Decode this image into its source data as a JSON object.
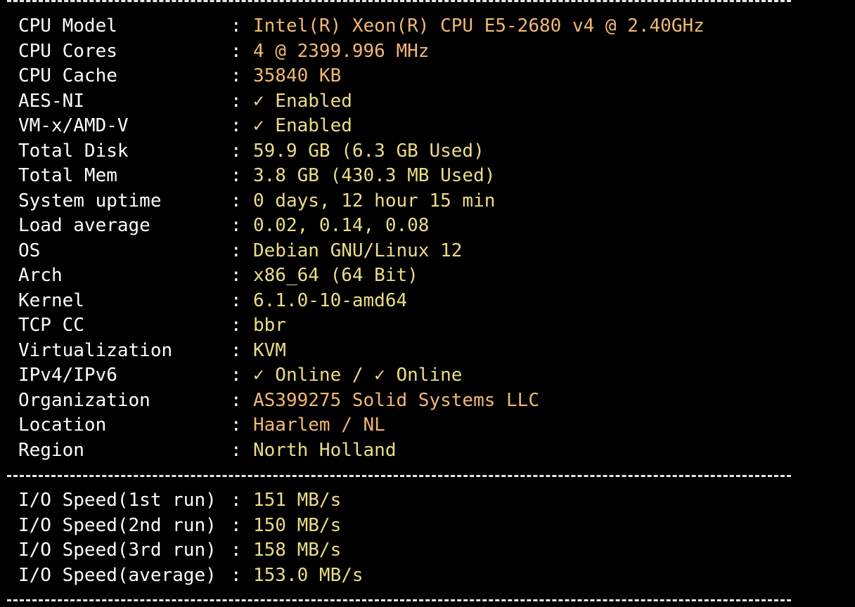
{
  "colors": {
    "background": "#000000",
    "label": "#ffffff",
    "value_orange": "#f1b873",
    "value_yellow": "#ecdd85"
  },
  "separator": ":",
  "system_info": [
    {
      "label": "CPU Model",
      "value": "Intel(R) Xeon(R) CPU E5-2680 v4 @ 2.40GHz",
      "color": "orange"
    },
    {
      "label": "CPU Cores",
      "value": "4 @ 2399.996 MHz",
      "color": "orange"
    },
    {
      "label": "CPU Cache",
      "value": "35840 KB",
      "color": "orange"
    },
    {
      "label": "AES-NI",
      "value": "✓ Enabled",
      "color": "yellow"
    },
    {
      "label": "VM-x/AMD-V",
      "value": "✓ Enabled",
      "color": "yellow"
    },
    {
      "label": "Total Disk",
      "value": "59.9 GB (6.3 GB Used)",
      "color": "yellow"
    },
    {
      "label": "Total Mem",
      "value": "3.8 GB (430.3 MB Used)",
      "color": "yellow"
    },
    {
      "label": "System uptime",
      "value": "0 days, 12 hour 15 min",
      "color": "yellow"
    },
    {
      "label": "Load average",
      "value": "0.02, 0.14, 0.08",
      "color": "yellow"
    },
    {
      "label": "OS",
      "value": "Debian GNU/Linux 12",
      "color": "yellow"
    },
    {
      "label": "Arch",
      "value": "x86_64 (64 Bit)",
      "color": "yellow"
    },
    {
      "label": "Kernel",
      "value": "6.1.0-10-amd64",
      "color": "yellow"
    },
    {
      "label": "TCP CC",
      "value": "bbr",
      "color": "yellow"
    },
    {
      "label": "Virtualization",
      "value": "KVM",
      "color": "yellow"
    },
    {
      "label": "IPv4/IPv6",
      "value": "✓ Online / ✓ Online",
      "color": "yellow"
    },
    {
      "label": "Organization",
      "value": "AS399275 Solid Systems LLC",
      "color": "orange"
    },
    {
      "label": "Location",
      "value": "Haarlem / NL",
      "color": "orange"
    },
    {
      "label": "Region",
      "value": "North Holland",
      "color": "yellow"
    }
  ],
  "io_speed": [
    {
      "label": "I/O Speed(1st run)",
      "value": "151 MB/s",
      "color": "yellow"
    },
    {
      "label": "I/O Speed(2nd run)",
      "value": "150 MB/s",
      "color": "yellow"
    },
    {
      "label": "I/O Speed(3rd run)",
      "value": "158 MB/s",
      "color": "yellow"
    },
    {
      "label": "I/O Speed(average)",
      "value": "153.0 MB/s",
      "color": "yellow"
    }
  ]
}
